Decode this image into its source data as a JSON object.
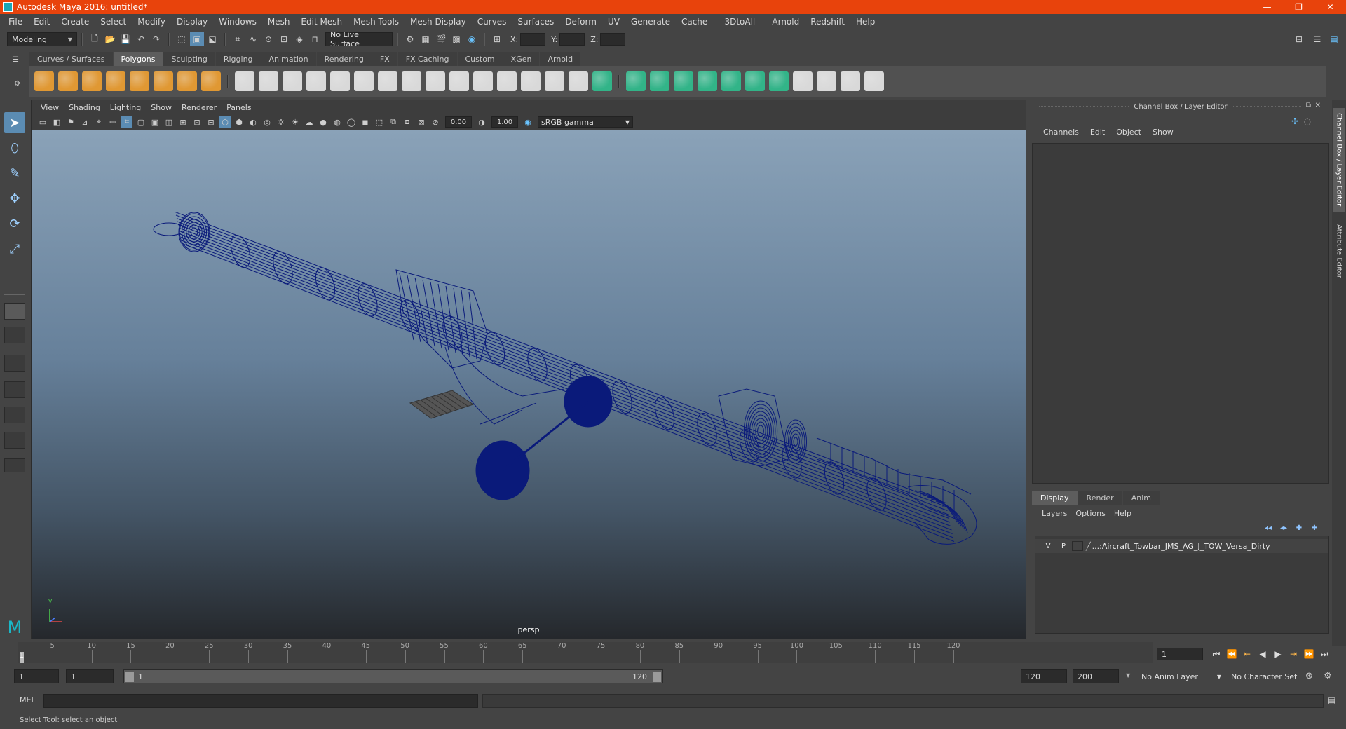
{
  "window": {
    "title": "Autodesk Maya 2016: untitled*",
    "buttons": [
      "—",
      "❐",
      "✕"
    ]
  },
  "menubar": [
    "File",
    "Edit",
    "Create",
    "Select",
    "Modify",
    "Display",
    "Windows",
    "Mesh",
    "Edit Mesh",
    "Mesh Tools",
    "Mesh Display",
    "Curves",
    "Surfaces",
    "Deform",
    "UV",
    "Generate",
    "Cache",
    "- 3DtoAll -",
    "Arnold",
    "Redshift",
    "Help"
  ],
  "statusline": {
    "mode": "Modeling",
    "live_surface": "No Live Surface",
    "x_label": "X:",
    "y_label": "Y:",
    "z_label": "Z:"
  },
  "shelf_tabs": [
    {
      "label": "Curves / Surfaces",
      "active": false
    },
    {
      "label": "Polygons",
      "active": true
    },
    {
      "label": "Sculpting",
      "active": false
    },
    {
      "label": "Rigging",
      "active": false
    },
    {
      "label": "Animation",
      "active": false
    },
    {
      "label": "Rendering",
      "active": false
    },
    {
      "label": "FX",
      "active": false
    },
    {
      "label": "FX Caching",
      "active": false
    },
    {
      "label": "Custom",
      "active": false
    },
    {
      "label": "XGen",
      "active": false
    },
    {
      "label": "Arnold",
      "active": false
    }
  ],
  "shelf_colors": {
    "primitive": "#f0a030",
    "tool": "#e8e8e8",
    "green": "#2fbf8f"
  },
  "viewport": {
    "menu": [
      "View",
      "Shading",
      "Lighting",
      "Show",
      "Renderer",
      "Panels"
    ],
    "exposure": "0.00",
    "gamma": "1.00",
    "color_space": "sRGB gamma",
    "camera": "persp",
    "axis_y": "y",
    "wire_color": "#0a1a7a"
  },
  "channel_box": {
    "title": "Channel Box / Layer Editor",
    "menu": [
      "Channels",
      "Edit",
      "Object",
      "Show"
    ]
  },
  "layer_editor": {
    "tabs": [
      {
        "label": "Display",
        "active": true
      },
      {
        "label": "Render",
        "active": false
      },
      {
        "label": "Anim",
        "active": false
      }
    ],
    "menu": [
      "Layers",
      "Options",
      "Help"
    ],
    "layer": {
      "v": "V",
      "p": "P",
      "name": "...:Aircraft_Towbar_JMS_AG_J_TOW_Versa_Dirty"
    }
  },
  "side_tabs": [
    "Channel Box / Layer Editor",
    "Attribute Editor"
  ],
  "timeline": {
    "start": 1,
    "end": 120,
    "ticks": [
      5,
      10,
      15,
      20,
      25,
      30,
      35,
      40,
      45,
      50,
      55,
      60,
      65,
      70,
      75,
      80,
      85,
      90,
      95,
      100,
      105,
      110,
      115,
      120
    ],
    "current_frame": "1"
  },
  "range": {
    "start_field": "1",
    "playback_start": "1",
    "slider_start": "1",
    "slider_end": "120",
    "playback_end": "120",
    "end_field": "200",
    "anim_layer": "No Anim Layer",
    "character_set": "No Character Set"
  },
  "command": {
    "label": "MEL",
    "help": "Select Tool: select an object"
  }
}
